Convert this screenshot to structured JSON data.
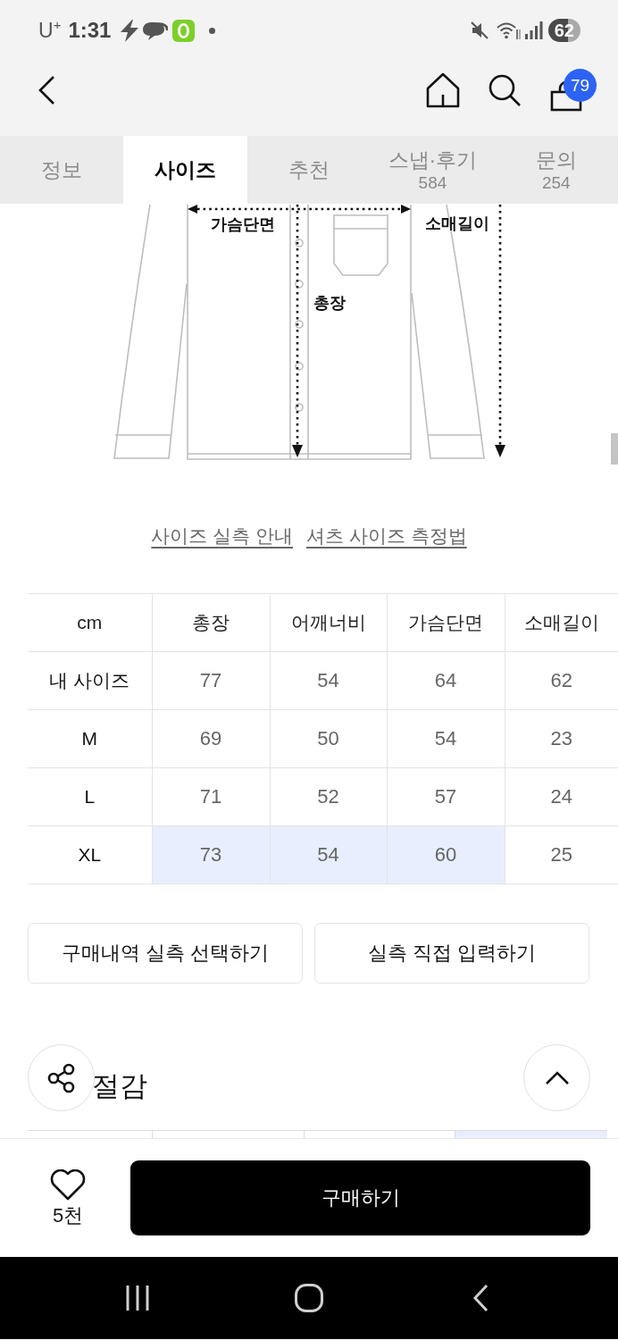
{
  "status_bar": {
    "carrier": "U$^{+}$",
    "time": "1:31",
    "battery": "62"
  },
  "header": {
    "cart_count": "79"
  },
  "tabs": [
    {
      "label": "정보",
      "selected": false
    },
    {
      "label": "사이즈",
      "selected": true
    },
    {
      "label": "추천",
      "selected": false
    },
    {
      "label": "스냅·후기",
      "count": "584",
      "selected": false
    },
    {
      "label": "문의",
      "count": "254",
      "selected": false
    }
  ],
  "size_diagram": {
    "labels": [
      {
        "kind": "chest",
        "text": "가슴단면"
      },
      {
        "kind": "length",
        "text": "총장"
      },
      {
        "kind": "sleeve",
        "text": "소매길이"
      }
    ]
  },
  "links": [
    "사이즈 실측 안내",
    "셔츠 사이즈 측정법"
  ],
  "size_table": {
    "columns": [
      "cm",
      "총장",
      "어깨너비",
      "가슴단면",
      "소매길이"
    ],
    "rows": [
      {
        "cells": [
          {
            "kind": "label",
            "value": "내 사이즈",
            "highlighted": false
          },
          {
            "kind": "value",
            "value": "77",
            "highlighted": false
          },
          {
            "kind": "value",
            "value": "54",
            "highlighted": false
          },
          {
            "kind": "value",
            "value": "64",
            "highlighted": false
          },
          {
            "kind": "value",
            "value": "62",
            "highlighted": false
          }
        ]
      },
      {
        "cells": [
          {
            "kind": "label",
            "value": "M",
            "highlighted": false
          },
          {
            "kind": "value",
            "value": "69",
            "highlighted": false
          },
          {
            "kind": "value",
            "value": "50",
            "highlighted": false
          },
          {
            "kind": "value",
            "value": "54",
            "highlighted": false
          },
          {
            "kind": "value",
            "value": "23",
            "highlighted": false
          }
        ]
      },
      {
        "cells": [
          {
            "kind": "label",
            "value": "L",
            "highlighted": false
          },
          {
            "kind": "value",
            "value": "71",
            "highlighted": false
          },
          {
            "kind": "value",
            "value": "52",
            "highlighted": false
          },
          {
            "kind": "value",
            "value": "57",
            "highlighted": false
          },
          {
            "kind": "value",
            "value": "24",
            "highlighted": false
          }
        ]
      },
      {
        "cells": [
          {
            "kind": "label",
            "value": "XL",
            "highlighted": false
          },
          {
            "kind": "value",
            "value": "73",
            "highlighted": true
          },
          {
            "kind": "value",
            "value": "54",
            "highlighted": true
          },
          {
            "kind": "value",
            "value": "60",
            "highlighted": true
          },
          {
            "kind": "value",
            "value": "25",
            "highlighted": false
          }
        ]
      }
    ]
  },
  "actions": [
    "구매내역 실측 선택하기",
    "실측 직접 입력하기"
  ],
  "section": {
    "title": "절감"
  },
  "next_table": {
    "cells": [
      {
        "highlighted": false
      },
      {
        "highlighted": false
      },
      {
        "highlighted": false
      },
      {
        "highlighted": true
      }
    ]
  },
  "bottom_bar": {
    "likes": "5천",
    "buy_label": "구매하기"
  }
}
